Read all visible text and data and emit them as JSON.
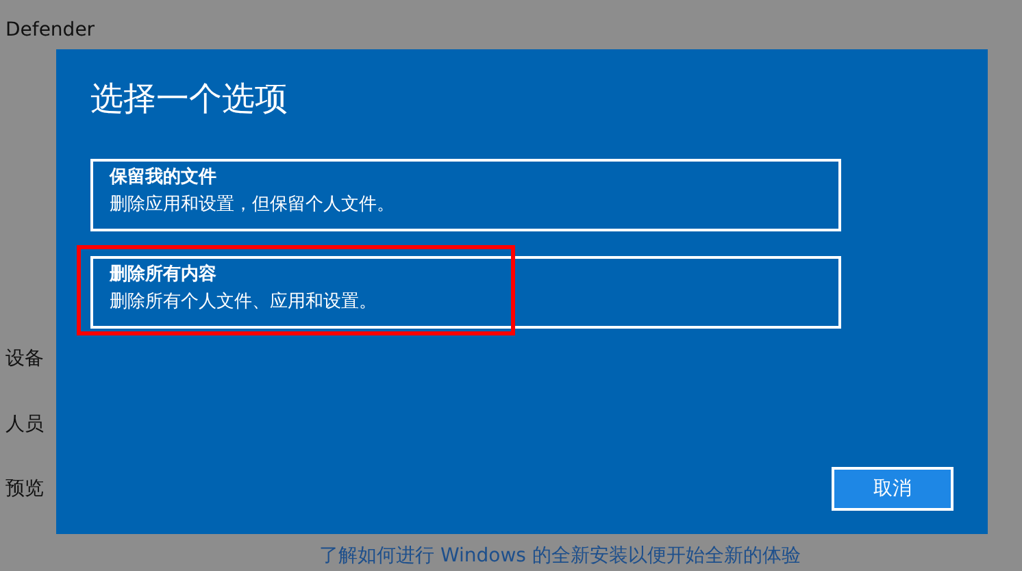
{
  "background": {
    "sidebar_items": [
      "Defender",
      "设备",
      "人员",
      "预览"
    ],
    "link": "了解如何进行 Windows 的全新安装以便开始全新的体验"
  },
  "dialog": {
    "title": "选择一个选项",
    "options": [
      {
        "title": "保留我的文件",
        "description": "删除应用和设置，但保留个人文件。",
        "highlighted": false
      },
      {
        "title": "删除所有内容",
        "description": "删除所有个人文件、应用和设置。",
        "highlighted": true
      }
    ],
    "buttons": [
      "取消"
    ]
  }
}
